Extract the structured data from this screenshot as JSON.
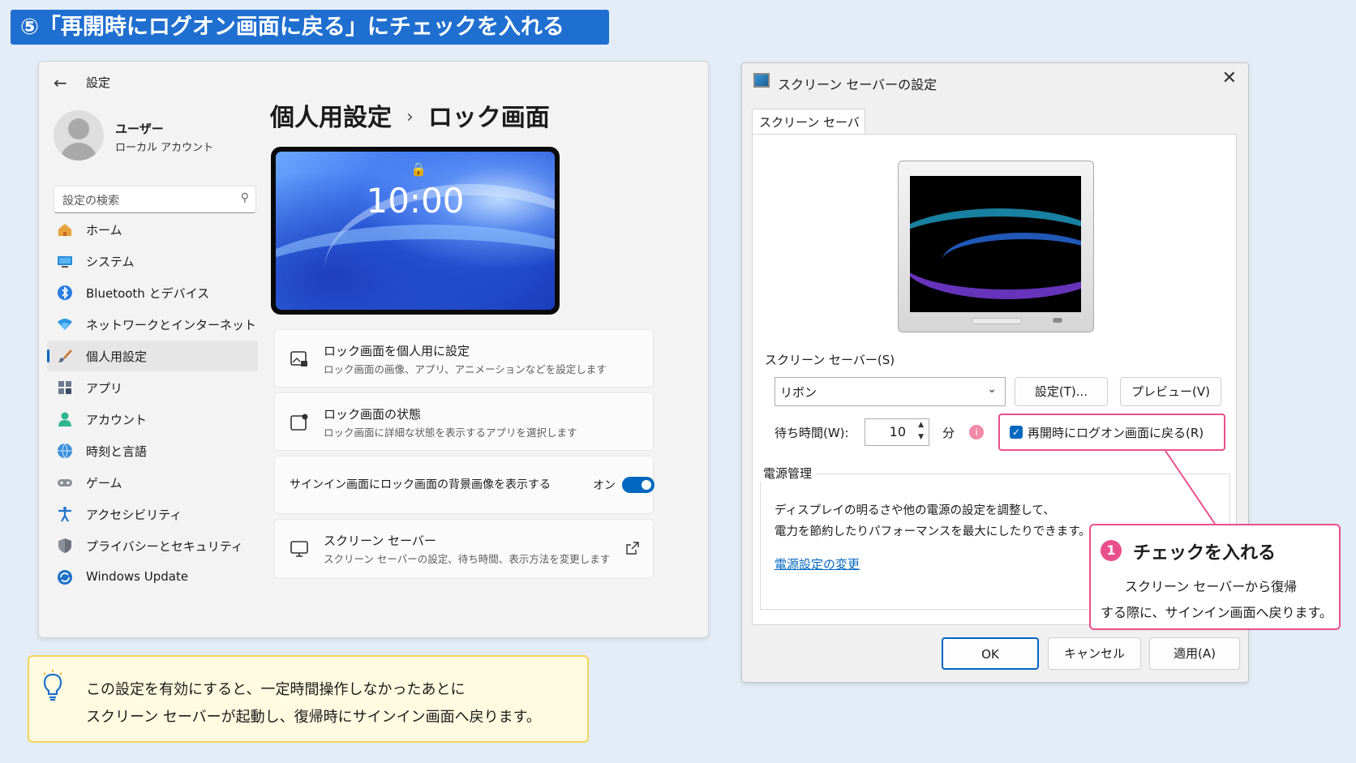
{
  "banner": {
    "text": "⑤「再開時にログオン画面に戻る」にチェックを入れる"
  },
  "settings": {
    "window_title": "設定",
    "user": {
      "name": "ユーザー",
      "account_type": "ローカル アカウント"
    },
    "search_placeholder": "設定の検索",
    "nav": [
      {
        "label": "ホーム",
        "icon": "home-icon",
        "selected": false
      },
      {
        "label": "システム",
        "icon": "system-icon",
        "selected": false
      },
      {
        "label": "Bluetooth とデバイス",
        "icon": "bluetooth-icon",
        "selected": false
      },
      {
        "label": "ネットワークとインターネット",
        "icon": "wifi-icon",
        "selected": false
      },
      {
        "label": "個人用設定",
        "icon": "brush-icon",
        "selected": true
      },
      {
        "label": "アプリ",
        "icon": "apps-icon",
        "selected": false
      },
      {
        "label": "アカウント",
        "icon": "account-icon",
        "selected": false
      },
      {
        "label": "時刻と言語",
        "icon": "globe-clock-icon",
        "selected": false
      },
      {
        "label": "ゲーム",
        "icon": "gamepad-icon",
        "selected": false
      },
      {
        "label": "アクセシビリティ",
        "icon": "accessibility-icon",
        "selected": false
      },
      {
        "label": "プライバシーとセキュリティ",
        "icon": "shield-icon",
        "selected": false
      },
      {
        "label": "Windows Update",
        "icon": "update-icon",
        "selected": false
      }
    ],
    "breadcrumb": {
      "parent": "個人用設定",
      "separator": "›",
      "current": "ロック画面"
    },
    "lock_preview_time": "10:00",
    "cards": [
      {
        "title": "ロック画面を個人用に設定",
        "subtitle": "ロック画面の画像、アプリ、アニメーションなどを設定します"
      },
      {
        "title": "ロック画面の状態",
        "subtitle": "ロック画面に詳細な状態を表示するアプリを選択します"
      },
      {
        "title": "サインイン画面にロック画面の背景画像を表示する",
        "toggle_label": "オン",
        "toggle_on": true
      },
      {
        "title": "スクリーン セーバー",
        "subtitle": "スクリーン セーバーの設定、待ち時間、表示方法を変更します"
      }
    ]
  },
  "screensaver_dialog": {
    "title": "スクリーン セーバーの設定",
    "tab": "スクリーン セーバー",
    "group_label": "スクリーン セーバー(S)",
    "selected_saver": "リボン",
    "settings_button": "設定(T)...",
    "preview_button": "プレビュー(V)",
    "wait_label": "待ち時間(W):",
    "wait_value": "10",
    "wait_unit": "分",
    "info_badge": "i",
    "resume_checkbox": {
      "label": "再開時にログオン画面に戻る(R)",
      "checked": true
    },
    "power_group_label": "電源管理",
    "power_text_1": "ディスプレイの明るさや他の電源の設定を調整して、",
    "power_text_2": "電力を節約したりパフォーマンスを最大にしたりできます。",
    "power_link": "電源設定の変更",
    "ok": "OK",
    "cancel": "キャンセル",
    "apply": "適用(A)"
  },
  "callout": {
    "badge": "1",
    "title": "チェックを入れる",
    "line1": "スクリーン セーバーから復帰",
    "line2": "する際に、サインイン画面へ戻ります。"
  },
  "tip": {
    "line1": "この設定を有効にすると、一定時間操作しなかったあとに",
    "line2": "スクリーン セーバーが起動し、復帰時にサインイン画面へ戻ります。"
  },
  "colors": {
    "banner_bg": "#1f6fd0",
    "accent": "#0067c0",
    "highlight_pink": "#e84f8b",
    "tip_bg": "#fffbe0",
    "tip_border": "#f2d45c",
    "page_bg": "#e4edf7"
  }
}
